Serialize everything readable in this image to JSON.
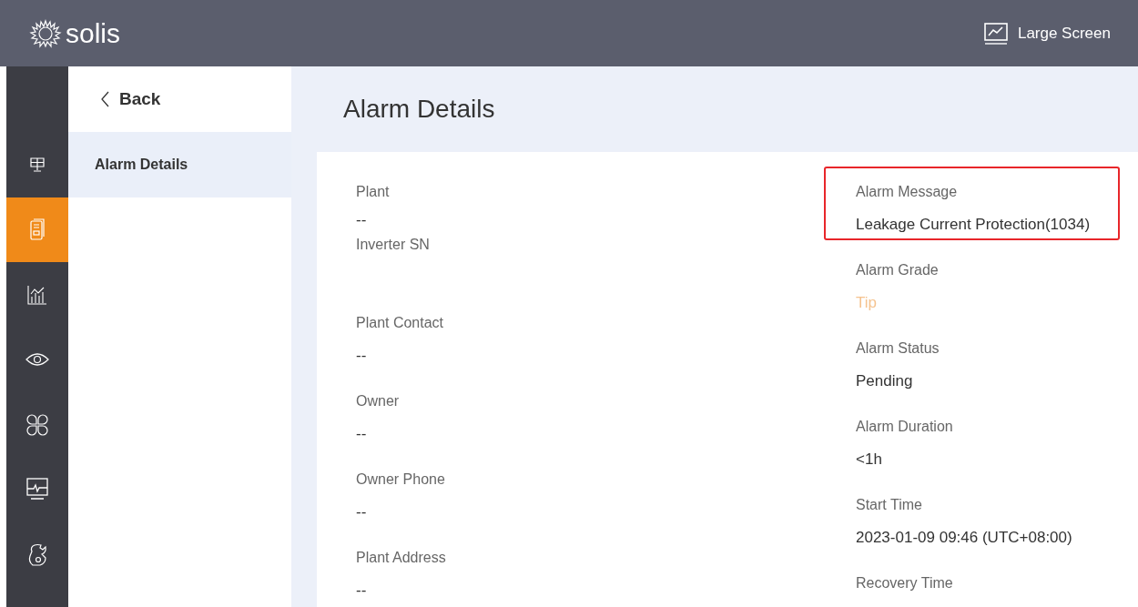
{
  "header": {
    "logo": "solis",
    "large_screen": "Large Screen"
  },
  "nav_rail": [
    {
      "selected": false
    },
    {
      "selected": true
    },
    {
      "selected": false
    },
    {
      "selected": false
    },
    {
      "selected": false
    },
    {
      "selected": false
    },
    {
      "selected": false
    }
  ],
  "subnav": {
    "back": "Back",
    "items": [
      {
        "label": "Alarm Details",
        "selected": true
      }
    ]
  },
  "page_title": "Alarm Details",
  "left_fields": [
    {
      "label": "Plant",
      "value": "--"
    },
    {
      "label": "Inverter SN"
    },
    {
      "label": "Plant Contact",
      "value": "--"
    },
    {
      "label": "Owner",
      "value": "--"
    },
    {
      "label": "Owner Phone",
      "value": "--"
    },
    {
      "label": "Plant Address",
      "value": "--"
    }
  ],
  "right_fields": [
    {
      "label": "Alarm Message",
      "value": "Leakage Current Protection(1034)",
      "kind": "text",
      "highlighted": true
    },
    {
      "label": "Alarm Grade",
      "value": "Tip",
      "kind": "grade",
      "highlighted": false
    },
    {
      "label": "Alarm Status",
      "value": "Pending",
      "kind": "text",
      "highlighted": false
    },
    {
      "label": "Alarm Duration",
      "value": "<1h",
      "kind": "text",
      "highlighted": false
    },
    {
      "label": "Start Time",
      "value": "2023-01-09 09:46 (UTC+08:00)",
      "kind": "text",
      "highlighted": false
    },
    {
      "label": "Recovery Time",
      "highlighted": false
    }
  ]
}
